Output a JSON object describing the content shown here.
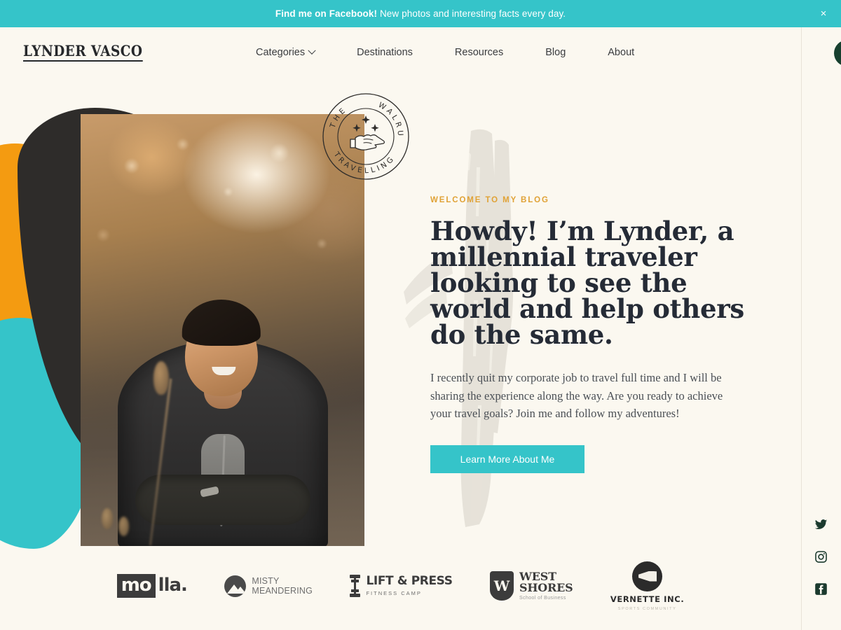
{
  "announcement": {
    "bold_text": "Find me on Facebook!",
    "rest_text": " New photos and interesting facts every day.",
    "close_label": "×",
    "background": "#35C4C9"
  },
  "header": {
    "logo": "LYNDER VASCO",
    "nav": [
      {
        "label": "Categories",
        "has_dropdown": true
      },
      {
        "label": "Destinations",
        "has_dropdown": false
      },
      {
        "label": "Resources",
        "has_dropdown": false
      },
      {
        "label": "Blog",
        "has_dropdown": false
      },
      {
        "label": "About",
        "has_dropdown": false
      }
    ],
    "search_icon": "search-icon"
  },
  "hero": {
    "eyebrow": "WELCOME TO MY BLOG",
    "headline": "Howdy! I’m Lynder, a millennial traveler looking to see the world and help others do the same.",
    "paragraph": "I recently quit my corporate job to travel full time and I will be sharing the experience along the way. Are you ready to achieve your travel goals?  Join me and follow my adventures!",
    "cta_label": "Learn More About Me",
    "photo_alt": "Smiling young man with arms crossed in an autumn field"
  },
  "stamp": {
    "top_text": "THE",
    "right_text": "WALRUS",
    "bottom_text": "TRAVELLING",
    "full_text": "THE TRAVELLING WALRUS",
    "icon": "pointing-hand-icon"
  },
  "brands": [
    {
      "name": "mo lla.",
      "mark": "mo",
      "word": "lla.",
      "icon": "molla-wordmark"
    },
    {
      "name": "MISTY MEANDERING",
      "line1": "MISTY",
      "line2": "MEANDERING",
      "icon": "mountain-circle-icon"
    },
    {
      "name": "LIFT & PRESS",
      "line1": "LIFT & PRESS",
      "line2": "FITNESS CAMP",
      "icon": "dumbbell-icon"
    },
    {
      "name": "WEST SHORES",
      "line1": "WEST",
      "line2": "SHORES",
      "line3": "School of Business",
      "mark": "W",
      "icon": "shield-icon"
    },
    {
      "name": "VERNETTE INC.",
      "line1": "VERNETTE INC.",
      "line2": "SPORTS COMMUNITY",
      "icon": "megaphone-icon"
    }
  ],
  "socials": [
    {
      "name": "twitter-icon",
      "label": "Twitter"
    },
    {
      "name": "instagram-icon",
      "label": "Instagram"
    },
    {
      "name": "facebook-icon",
      "label": "Facebook"
    }
  ],
  "colors": {
    "background": "#FBF8F0",
    "teal": "#35C4C9",
    "orange": "#F49B11",
    "dark": "#2E2C2A",
    "ink": "#252B36",
    "gold": "#E0A236",
    "deep_green": "#17402F"
  }
}
